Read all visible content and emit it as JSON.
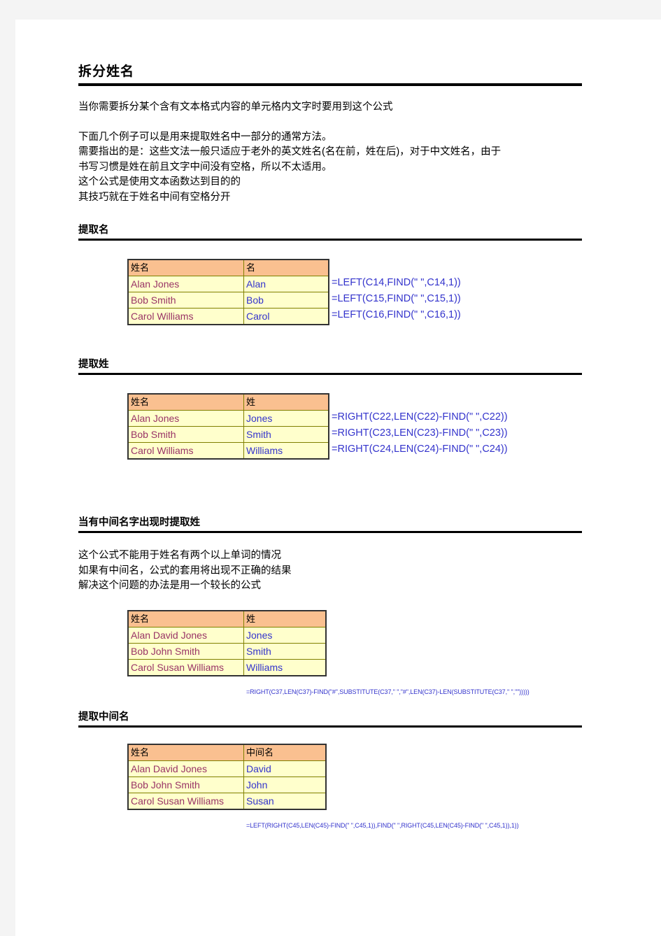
{
  "document": {
    "title": "拆分姓名",
    "intro_lines": [
      "当你需要拆分某个含有文本格式内容的单元格内文字时要用到这个公式"
    ],
    "body_lines": [
      "下面几个例子可以是用来提取姓名中一部分的通常方法。",
      "需要指出的是：这些文法一般只适应于老外的英文姓名(名在前，姓在后)，对于中文姓名，由于",
      "书写习惯是姓在前且文字中间没有空格，所以不太适用。",
      "这个公式是使用文本函数达到目的的",
      "其技巧就在于姓名中间有空格分开"
    ]
  },
  "sections": {
    "first_name": {
      "heading": "提取名",
      "table": {
        "headers": [
          "姓名",
          "名"
        ],
        "rows": [
          {
            "name": "Alan  Jones",
            "value": "Alan"
          },
          {
            "name": "Bob  Smith",
            "value": "Bob"
          },
          {
            "name": "Carol  Williams",
            "value": "Carol"
          }
        ]
      },
      "formulas": [
        "=LEFT(C14,FIND(\" \",C14,1))",
        "=LEFT(C15,FIND(\" \",C15,1))",
        "=LEFT(C16,FIND(\" \",C16,1))"
      ]
    },
    "last_name": {
      "heading": "提取姓",
      "table": {
        "headers": [
          "姓名",
          "姓"
        ],
        "rows": [
          {
            "name": "Alan  Jones",
            "value": "Jones"
          },
          {
            "name": "Bob  Smith",
            "value": "Smith"
          },
          {
            "name": "Carol  Williams",
            "value": "Williams"
          }
        ]
      },
      "formulas": [
        "=RIGHT(C22,LEN(C22)-FIND(\" \",C22))",
        "=RIGHT(C23,LEN(C23)-FIND(\" \",C23))",
        "=RIGHT(C24,LEN(C24)-FIND(\" \",C24))"
      ]
    },
    "last_name_with_middle": {
      "heading": "当有中间名字出现时提取姓",
      "notes": [
        "这个公式不能用于姓名有两个以上单词的情况",
        "如果有中间名，公式的套用将出现不正确的结果",
        "解决这个问题的办法是用一个较长的公式"
      ],
      "table": {
        "headers": [
          "姓名",
          "姓"
        ],
        "rows": [
          {
            "name": "Alan  David  Jones",
            "value": "Jones"
          },
          {
            "name": "Bob  John  Smith",
            "value": "Smith"
          },
          {
            "name": "Carol  Susan  Williams",
            "value": "Williams"
          }
        ]
      },
      "long_formula": "=RIGHT(C37,LEN(C37)-FIND(\"#\",SUBSTITUTE(C37,\" \",\"#\",LEN(C37)-LEN(SUBSTITUTE(C37,\" \",\"\")))))"
    },
    "middle_name": {
      "heading": "提取中间名",
      "table": {
        "headers": [
          "姓名",
          "中间名"
        ],
        "rows": [
          {
            "name": "Alan  David  Jones",
            "value": "David"
          },
          {
            "name": "Bob  John  Smith",
            "value": "John"
          },
          {
            "name": "Carol  Susan  Williams",
            "value": "Susan"
          }
        ]
      },
      "long_formula": "=LEFT(RIGHT(C45,LEN(C45)-FIND(\" \",C45,1)),FIND(\" \",RIGHT(C45,LEN(C45)-FIND(\" \",C45,1)),1))"
    }
  },
  "colors": {
    "header_fill": "#fac090",
    "cell_fill": "#ffffcc",
    "name_text": "#993366",
    "formula_text": "#3333cc",
    "cell_border": "#808000",
    "table_border": "#333333"
  }
}
